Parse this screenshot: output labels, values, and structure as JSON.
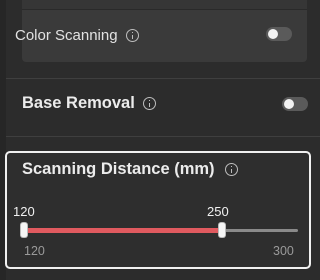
{
  "color_scanning": {
    "label": "Color Scanning",
    "enabled": false
  },
  "base_removal": {
    "label": "Base Removal",
    "enabled": false
  },
  "scanning_distance": {
    "label": "Scanning Distance (mm)",
    "range_min": "120",
    "range_max": "300",
    "selected_low": "120",
    "selected_high": "250",
    "min_value": 120,
    "max_value": 300,
    "low_value": 120,
    "high_value": 250,
    "fill_color": "#e05a5f"
  },
  "icons": {
    "info": "info-icon"
  }
}
